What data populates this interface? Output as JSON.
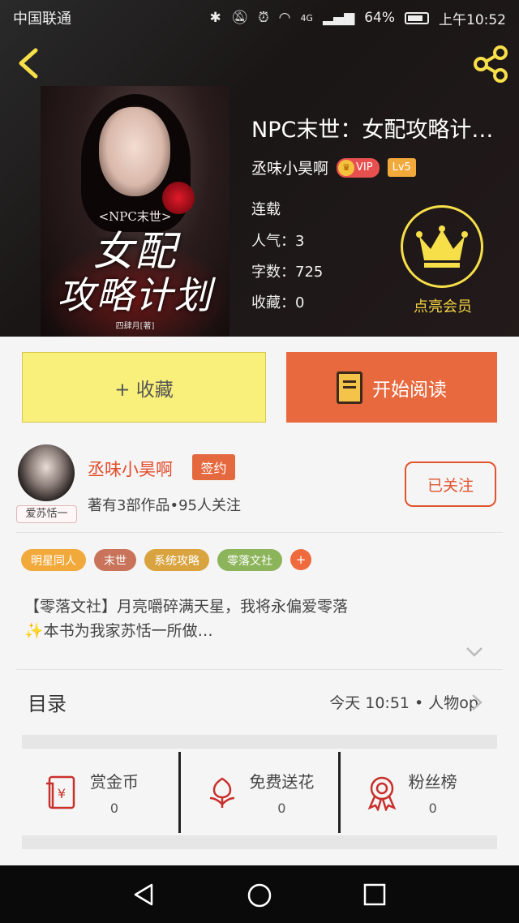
{
  "status_bar": {
    "carrier": "中国联通",
    "network": "4G",
    "battery": "64%",
    "time": "上午10:52"
  },
  "book": {
    "title": "NPC末世：女配攻略计…",
    "author": "丞味小昊啊",
    "vip_label": "VIP",
    "level": "Lv5",
    "status": "连载",
    "popularity": "人气：3",
    "word_count": "字数：725",
    "favorites": "收藏：0",
    "member_label": "点亮会员"
  },
  "cover": {
    "subtitle": "<NPC末世>",
    "title_line1": "女配",
    "title_line2": "攻略计划",
    "author_line": "四肆月[著]"
  },
  "buttons": {
    "favorite": "+ 收藏",
    "read": "开始阅读"
  },
  "author_card": {
    "name": "丞味小昊啊",
    "sign_badge": "签约",
    "info": "著有3部作品•95人关注",
    "avatar_tag": "爱苏恬一",
    "follow": "已关注"
  },
  "tags": [
    {
      "label": "明星同人",
      "color": "#f2a93b"
    },
    {
      "label": "末世",
      "color": "#c8735a"
    },
    {
      "label": "系统攻略",
      "color": "#d9a440"
    },
    {
      "label": "零落文社",
      "color": "#8cb45a"
    }
  ],
  "tag_more": "+",
  "description": {
    "line1": "【零落文社】月亮嚼碎满天星，我将永偏爱零落",
    "line2": "✨本书为我家苏恬一所做…"
  },
  "toc": {
    "label": "目录",
    "latest": "今天 10:51 • 人物op"
  },
  "actions": [
    {
      "label": "赏金币",
      "value": "0",
      "icon": "red-envelope-icon"
    },
    {
      "label": "免费送花",
      "value": "0",
      "icon": "flower-icon"
    },
    {
      "label": "粉丝榜",
      "value": "0",
      "icon": "medal-icon"
    }
  ],
  "colors": {
    "accent": "#e8693d",
    "favorite_bg": "#f8f07a",
    "member_gold": "#f7df4a"
  }
}
